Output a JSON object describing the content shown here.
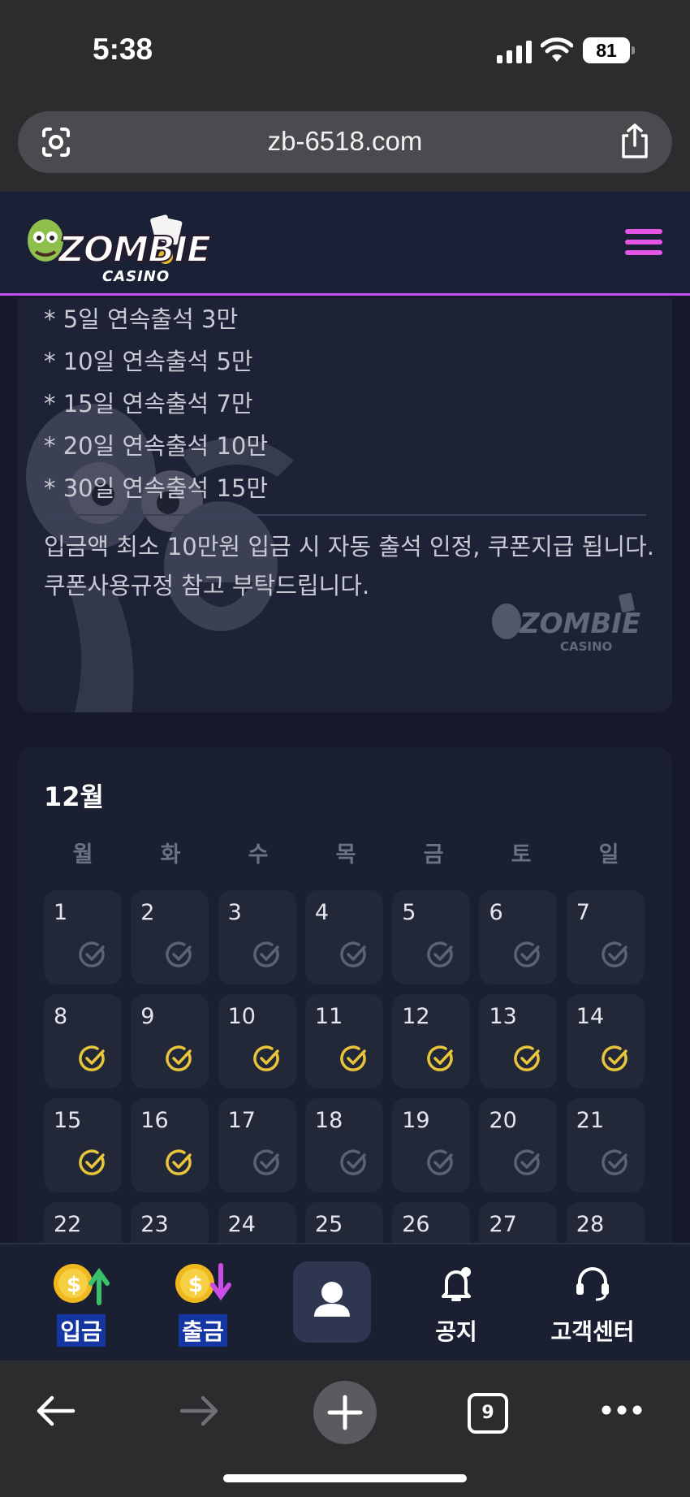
{
  "status_bar": {
    "time": "5:38",
    "battery": "81"
  },
  "browser": {
    "url": "zb-6518.com",
    "tab_count": "9"
  },
  "site": {
    "logo_text": "ZOMBIE",
    "logo_sub": "CASINO"
  },
  "attendance": {
    "items": [
      "* 5일 연속출석 3만",
      "* 10일 연속출석 5만",
      "* 15일 연속출석 7만",
      "* 20일 연속출석 10만",
      "* 30일 연속출석 15만"
    ],
    "notice_line1": "입금액 최소 10만원 입금 시 자동 출석 인정, 쿠폰지급 됩니다.",
    "notice_line2": "쿠폰사용규정 참고 부탁드립니다."
  },
  "calendar": {
    "month": "12월",
    "weekdays": [
      "월",
      "화",
      "수",
      "목",
      "금",
      "토",
      "일"
    ],
    "days": [
      {
        "n": "1",
        "checked": false
      },
      {
        "n": "2",
        "checked": false
      },
      {
        "n": "3",
        "checked": false
      },
      {
        "n": "4",
        "checked": false
      },
      {
        "n": "5",
        "checked": false
      },
      {
        "n": "6",
        "checked": false
      },
      {
        "n": "7",
        "checked": false
      },
      {
        "n": "8",
        "checked": true
      },
      {
        "n": "9",
        "checked": true
      },
      {
        "n": "10",
        "checked": true
      },
      {
        "n": "11",
        "checked": true
      },
      {
        "n": "12",
        "checked": true
      },
      {
        "n": "13",
        "checked": true
      },
      {
        "n": "14",
        "checked": true
      },
      {
        "n": "15",
        "checked": true
      },
      {
        "n": "16",
        "checked": true
      },
      {
        "n": "17",
        "checked": false
      },
      {
        "n": "18",
        "checked": false
      },
      {
        "n": "19",
        "checked": false
      },
      {
        "n": "20",
        "checked": false
      },
      {
        "n": "21",
        "checked": false
      },
      {
        "n": "22",
        "checked": false
      },
      {
        "n": "23",
        "checked": false
      },
      {
        "n": "24",
        "checked": false
      },
      {
        "n": "25",
        "checked": false
      },
      {
        "n": "26",
        "checked": false
      },
      {
        "n": "27",
        "checked": false
      },
      {
        "n": "28",
        "checked": false
      }
    ],
    "check_on_color": "#e8c53a",
    "check_off_color": "#5c6173"
  },
  "bottom_nav": {
    "deposit": "입금",
    "withdraw": "출금",
    "notice": "공지",
    "support": "고객센터"
  },
  "colors": {
    "accent": "#c84df0",
    "menu": "#e455e6"
  }
}
